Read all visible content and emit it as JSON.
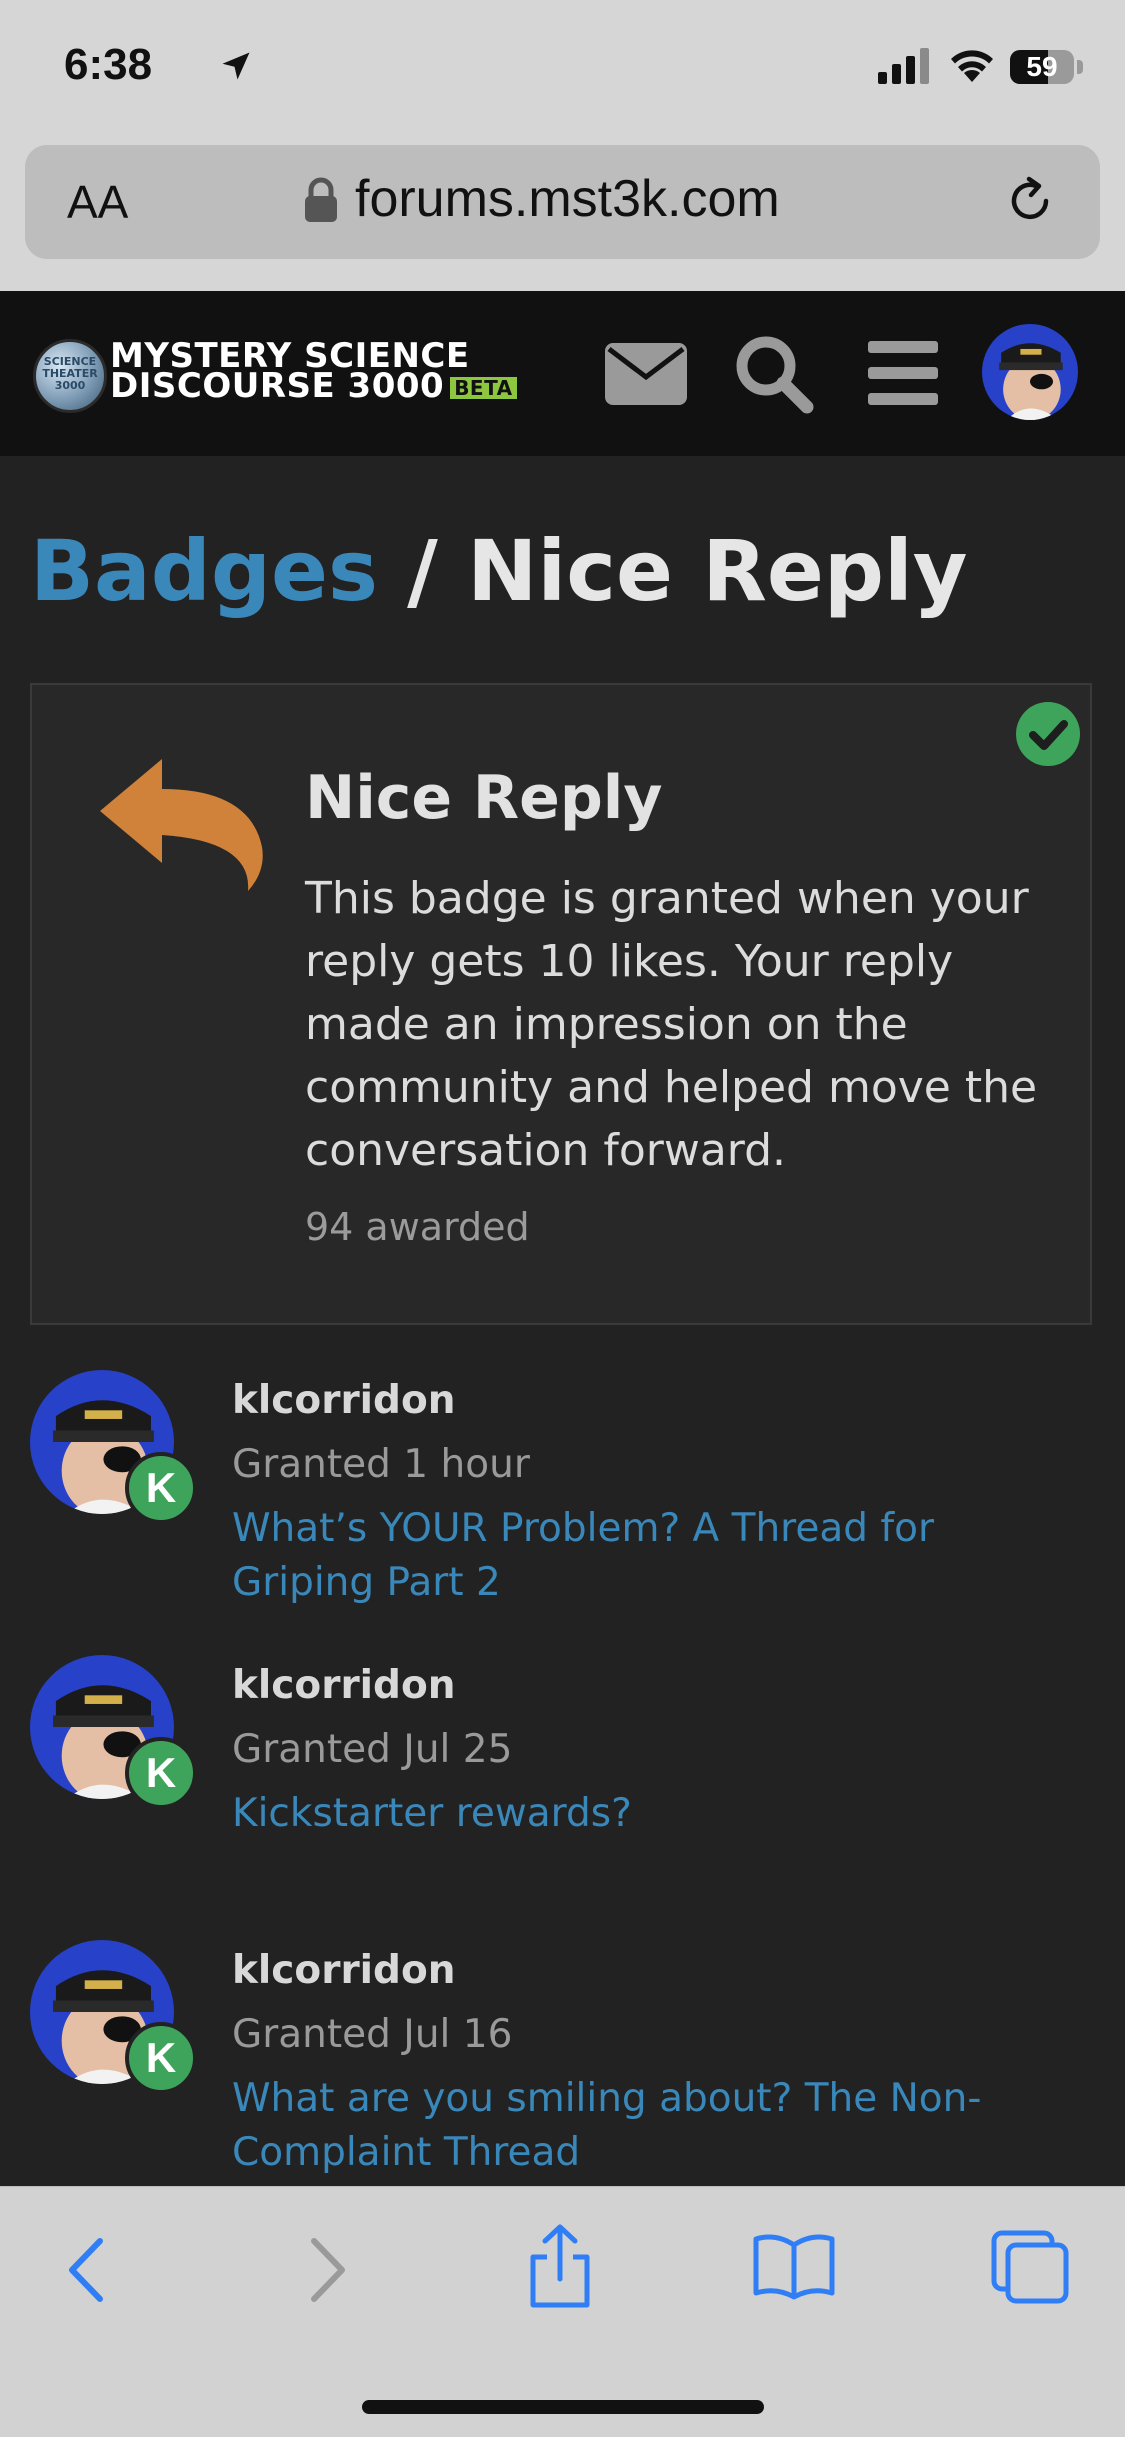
{
  "status_bar": {
    "time": "6:38",
    "battery": "59",
    "battery_level_pct": 59
  },
  "browser": {
    "text_size_label": "AA",
    "url": "forums.mst3k.com"
  },
  "header": {
    "logo_line1": "MYSTERY SCIENCE",
    "logo_line2": "DISCOURSE 3000",
    "logo_beta": "BETA",
    "logo_orb_text": "SCIENCE THEATER 3000",
    "icons": [
      "envelope-icon",
      "search-icon",
      "hamburger-menu-icon"
    ]
  },
  "breadcrumb": {
    "parent": "Badges",
    "separator": " / ",
    "current": "Nice Reply"
  },
  "badge": {
    "name": "Nice Reply",
    "description": "This badge is granted when your reply gets 10 likes. Your reply made an impression on the community and helped move the conversation forward.",
    "awarded": "94 awarded",
    "icon_color": "#d0813a",
    "granted_check_color": "#3fa45b"
  },
  "grants": [
    {
      "username": "klcorridon",
      "granted": "Granted 1 hour",
      "topic": "What’s YOUR Problem? A Thread for Griping Part 2",
      "badge_letter": "K"
    },
    {
      "username": "klcorridon",
      "granted": "Granted Jul 25",
      "topic": "Kickstarter rewards?",
      "badge_letter": "K"
    },
    {
      "username": "klcorridon",
      "granted": "Granted Jul 16",
      "topic": "What are you smiling about? The Non-Complaint Thread",
      "badge_letter": "K"
    }
  ],
  "colors": {
    "link": "#3a87b9",
    "background": "#222222",
    "header_bg": "#111111",
    "ios_accent": "#2f7ef6"
  }
}
